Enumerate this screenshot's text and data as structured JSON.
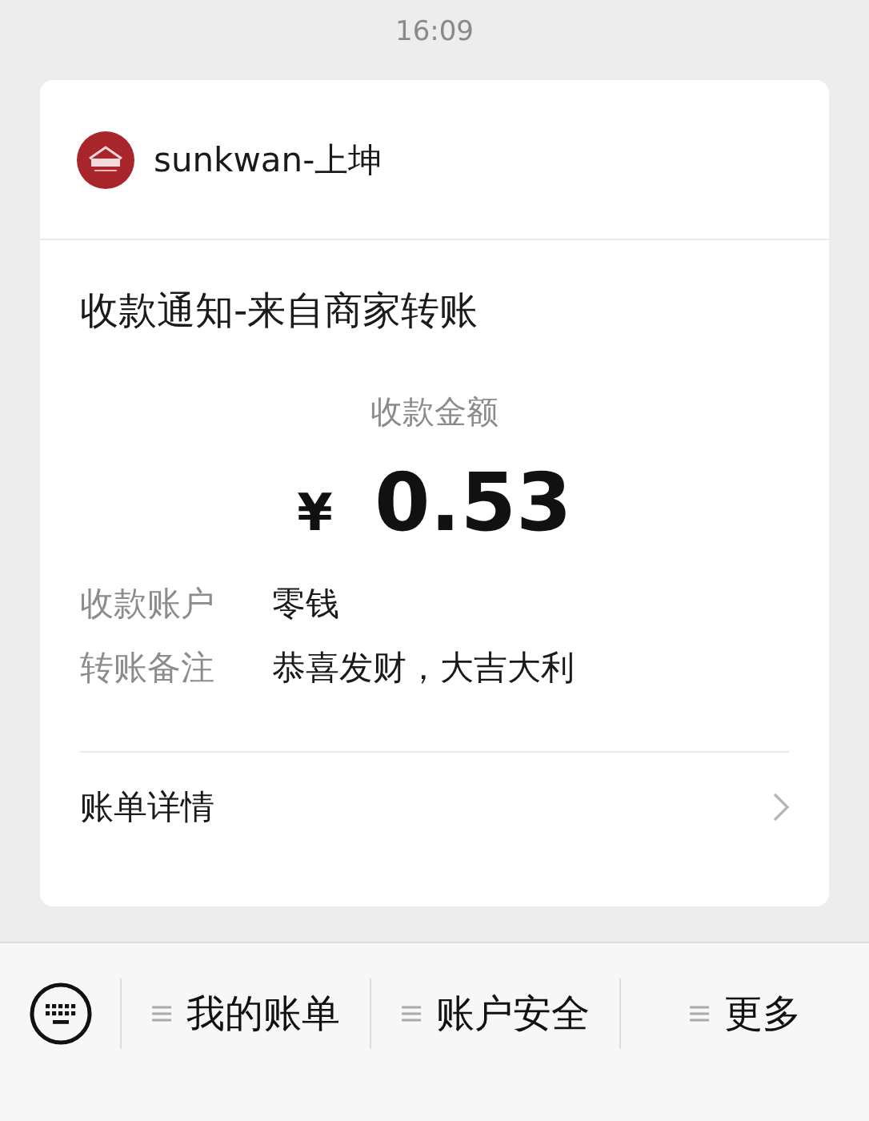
{
  "time": "16:09",
  "card": {
    "merchant": "sunkwan-上坤",
    "title": "收款通知-来自商家转账",
    "amount_label": "收款金额",
    "currency": "¥",
    "amount": "0.53",
    "fields": [
      {
        "label": "收款账户",
        "value": "零钱"
      },
      {
        "label": "转账备注",
        "value": "恭喜发财，大吉大利"
      }
    ],
    "details_link": "账单详情"
  },
  "menu": [
    {
      "label": "我的账单"
    },
    {
      "label": "账户安全"
    },
    {
      "label": "更多"
    }
  ]
}
